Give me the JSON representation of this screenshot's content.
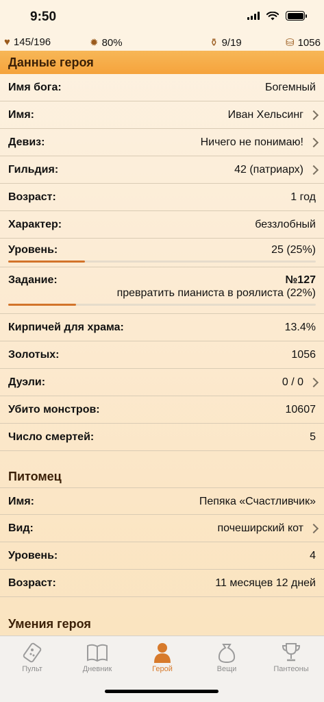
{
  "status": {
    "time": "9:50"
  },
  "stats": {
    "health": "145/196",
    "godpower": "80%",
    "inventory": "9/19",
    "gold": "1056"
  },
  "hero_section": {
    "title": "Данные героя",
    "god_name": {
      "label": "Имя бога:",
      "value": "Богемный"
    },
    "name": {
      "label": "Имя:",
      "value": "Иван Хельсинг"
    },
    "motto": {
      "label": "Девиз:",
      "value": "Ничего не понимаю!"
    },
    "guild": {
      "label": "Гильдия:",
      "value": "42 (патриарх)"
    },
    "age": {
      "label": "Возраст:",
      "value": "1 год"
    },
    "character": {
      "label": "Характер:",
      "value": "беззлобный"
    },
    "level": {
      "label": "Уровень:",
      "value": "25 (25%)",
      "progress": 0.25
    },
    "quest": {
      "label": "Задание:",
      "number": "№127",
      "value": "превратить пианиста в роялиста (22%)",
      "progress": 0.22
    },
    "bricks": {
      "label": "Кирпичей для храма:",
      "value": "13.4%"
    },
    "gold": {
      "label": "Золотых:",
      "value": "1056"
    },
    "duels": {
      "label": "Дуэли:",
      "value": "0 / 0"
    },
    "monsters": {
      "label": "Убито монстров:",
      "value": "10607"
    },
    "deaths": {
      "label": "Число смертей:",
      "value": "5"
    }
  },
  "pet_section": {
    "title": "Питомец",
    "name": {
      "label": "Имя:",
      "value": "Пепяка «Счастливчик»"
    },
    "kind": {
      "label": "Вид:",
      "value": "почеширский кот"
    },
    "level": {
      "label": "Уровень:",
      "value": "4"
    },
    "age": {
      "label": "Возраст:",
      "value": "11 месяцев 12 дней"
    }
  },
  "skills_section": {
    "title": "Умения героя"
  },
  "tabbar": {
    "tabs": [
      {
        "label": "Пульт",
        "icon": "remote-icon"
      },
      {
        "label": "Дневник",
        "icon": "book-icon"
      },
      {
        "label": "Герой",
        "icon": "hero-icon",
        "active": true
      },
      {
        "label": "Вещи",
        "icon": "bag-icon"
      },
      {
        "label": "Пантеоны",
        "icon": "trophy-icon"
      }
    ],
    "active_color": "#d77a2b"
  },
  "colors": {
    "accent": "#f5a33c",
    "progress": "#d2732a"
  }
}
